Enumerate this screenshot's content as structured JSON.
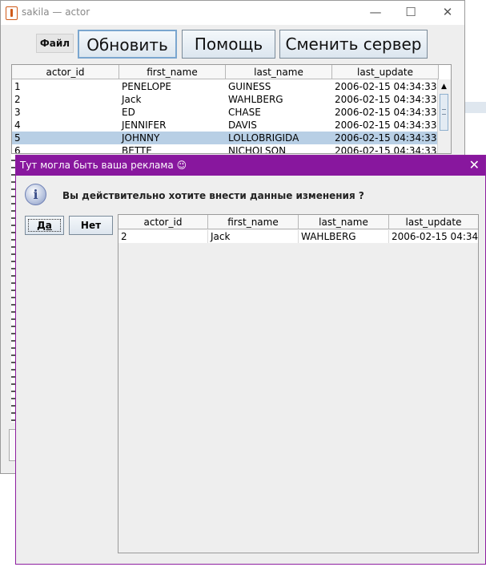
{
  "window": {
    "title": "sakila — actor",
    "controls": {
      "minimize": "—",
      "maximize": "☐",
      "close": "✕"
    }
  },
  "toolbar": {
    "file_label": "Файл",
    "refresh_label": "Обновить",
    "help_label": "Помощь",
    "change_server_label": "Сменить сервер"
  },
  "table": {
    "columns": [
      "actor_id",
      "first_name",
      "last_name",
      "last_update"
    ],
    "rows": [
      [
        "1",
        "PENELOPE",
        "GUINESS",
        "2006-02-15 04:34:33.0"
      ],
      [
        "2",
        "Jack",
        "WAHLBERG",
        "2006-02-15 04:34:33.0"
      ],
      [
        "3",
        "ED",
        "CHASE",
        "2006-02-15 04:34:33.0"
      ],
      [
        "4",
        "JENNIFER",
        "DAVIS",
        "2006-02-15 04:34:33.0"
      ],
      [
        "5",
        "JOHNNY",
        "LOLLOBRIGIDA",
        "2006-02-15 04:34:33.0"
      ],
      [
        "6",
        "BETTE",
        "NICHOLSON",
        "2006-02-15 04:34:33.0"
      ]
    ],
    "selected_row": 4,
    "scroll_up_glyph": "▲"
  },
  "dialog": {
    "title": "Тут могла быть ваша реклама 😉",
    "close_glyph": "✕",
    "icon_glyph": "i",
    "message": "Вы действительно хотите внести данные изменения ?",
    "yes_label": "Да",
    "no_label": "Нет",
    "table": {
      "columns": [
        "actor_id",
        "first_name",
        "last_name",
        "last_update"
      ],
      "rows": [
        [
          "2",
          "Jack",
          "WAHLBERG",
          "2006-02-15 04:34..."
        ]
      ]
    }
  },
  "colors": {
    "dialog_title_bg": "#88179e",
    "selection_bg": "#b8cfe5"
  }
}
